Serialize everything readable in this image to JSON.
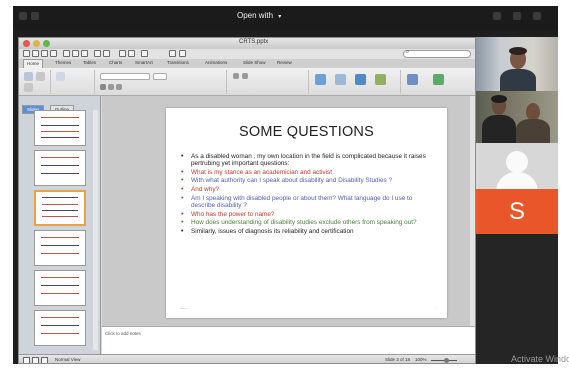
{
  "toolbar": {
    "open_with": "Open with",
    "chevron": "▾"
  },
  "ppt": {
    "file_name": "CRTS.pptx",
    "tabs": [
      "Home",
      "Themes",
      "Tables",
      "Charts",
      "SmartArt",
      "Transitions",
      "Animations",
      "Slide Show",
      "Review"
    ],
    "sidebar_tabs": [
      "Slides",
      "Outline"
    ],
    "notes_placeholder": "Click to add notes",
    "status_view": "Normal View",
    "status_slide": "Slide 3 of 18",
    "status_zoom": "100%"
  },
  "slide": {
    "title": "SOME QUESTIONS",
    "bullets": [
      {
        "text": "As a disabled  woman , my own location in the field is complicated because it raises pertrubing yet important questions:",
        "color": "#1d1d1d"
      },
      {
        "text": "What is my stance as an academician and activist",
        "color": "#c0392b"
      },
      {
        "text": "With what authority can I speak about disability and Disability Studies ?",
        "color": "#4e5db8"
      },
      {
        "text": "And why?",
        "color": "#c0392b"
      },
      {
        "text": "Am I speaking with disabled people or about them? What language do I use to  describe disability ?",
        "color": "#4e5db8"
      },
      {
        "text": "Who has the power to name?",
        "color": "#c0392b"
      },
      {
        "text": "How does understanding of disability studies  exclude others from speaking out?",
        "color": "#4a7d3a"
      },
      {
        "text": "Similarly, issues of  diagnosis its  reliability  and certification",
        "color": "#1d1d1d"
      }
    ]
  },
  "participants": {
    "letter_tile": "S",
    "letter_color": "#e8562a"
  },
  "watermark": "Activate Windows"
}
